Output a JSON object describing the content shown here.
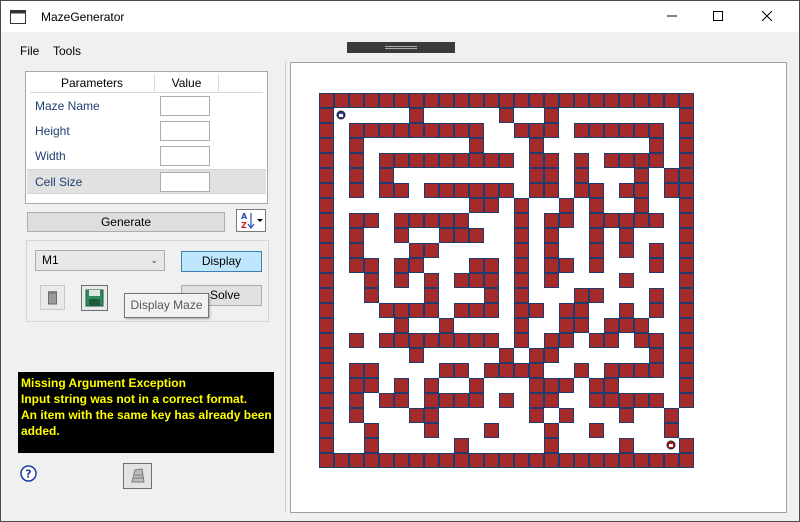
{
  "window": {
    "title": "MazeGenerator"
  },
  "menu": {
    "file": "File",
    "tools": "Tools"
  },
  "parameters": {
    "header_name": "Parameters",
    "header_value": "Value",
    "rows": [
      {
        "label": "Maze Name",
        "value": ""
      },
      {
        "label": "Height",
        "value": ""
      },
      {
        "label": "Width",
        "value": ""
      },
      {
        "label": "Cell Size",
        "value": ""
      }
    ]
  },
  "actions": {
    "generate": "Generate",
    "maze_select": "M1",
    "display": "Display",
    "solve": "Solve",
    "tooltip": "Display Maze"
  },
  "console": {
    "lines": [
      "Missing Argument Exception",
      "Input string was not in a correct format.",
      "An item with the same key has already been",
      "added."
    ]
  },
  "colors": {
    "wall": "#a52a2a",
    "wall_border": "#1e3a6e",
    "console_text": "#ffff00",
    "display_button": "#bee6fd"
  },
  "icons": [
    "app-icon",
    "minimize-icon",
    "maximize-icon",
    "close-icon",
    "sort-az-icon",
    "trash-icon",
    "save-icon",
    "help-icon",
    "tool-icon",
    "start-marker-icon",
    "goal-marker-icon"
  ],
  "maze": {
    "rows": [
      "#########################",
      "#S    #     #  #        #",
      "# #########  ### ######.#",
      "# #       #   #       # #",
      "# # ######### ## # #### #",
      "# # #         ## #   # ##",
      "# # ## ###### ## ## ## ##",
      "#         ## #  # #  #  #",
      "# ## #####   # ## ##### #",
      "# #  #  ###  # #  # #   #",
      "# #   ##     # #  # # # #",
      "# ## ##   ## # ## #   # #",
      "#  # # # ### # #    #   #",
      "#  #   #   # #   ##   # #",
      "#   #### ### ## ##  # # #",
      "#    #  #    #  ## ###  #",
      "# # ######## # ## ## ## #",
      "#     #     # ##      # #",
      "# ##    ## ####  # #### #",
      "# ## # #  #   ### ##    #",
      "# # ## #### # ##  ##### #",
      "# #   ##      # #   #  #",
      "#  #   #   #   #  #    #",
      "#  #     #     #    #  G#",
      "#########################"
    ]
  }
}
